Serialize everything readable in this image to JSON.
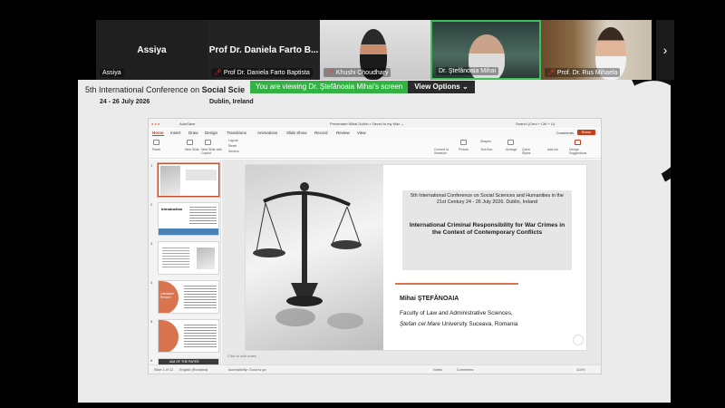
{
  "participants": [
    {
      "name": "Assiya",
      "label": "Assiya",
      "muted": false
    },
    {
      "name": "Prof Dr. Daniela Farto B...",
      "label": "Prof Dr. Daniela Farto Baptista",
      "muted": true
    },
    {
      "label": "Khushi Choudhary",
      "muted": true
    },
    {
      "label": "Dr. Ştefănoaia Mihai",
      "muted": false
    },
    {
      "label": "Prof. Dr. Rus Mihaela",
      "muted": true
    }
  ],
  "next_arrow": "›",
  "view_banner": {
    "viewing": "You are viewing  Dr. Ştefănoaia Mihai's screen",
    "options": "View Options ⌄"
  },
  "conference": {
    "header_prefix": "5th International Conference on ",
    "header_bold": "Social Scie",
    "dates": "24 - 26 July 2026",
    "place": "Dublin, Ireland"
  },
  "ppt": {
    "file_title": "Prezentare Mihai Dublin  •  Saved to my Mac ⌄",
    "autosave": "AutoSave",
    "search": "Search (Cmd + Ctrl + U)",
    "menu": [
      "Home",
      "Insert",
      "Draw",
      "Design",
      "Transitions",
      "Animations",
      "Slide Show",
      "Record",
      "Review",
      "View"
    ],
    "comments_btn": "Comments",
    "share_btn": "Share",
    "ribbon": {
      "paste": "Paste",
      "new_slide": "New Slide",
      "new_slide_copilot": "New Slide with Copilot",
      "layout": "Layout",
      "reset": "Reset",
      "section": "Section",
      "convert": "Convert to SmartArt",
      "picture": "Picture",
      "shapes": "Shapes",
      "text_box": "Text Box",
      "arrange": "Arrange",
      "quick_styles": "Quick Styles",
      "add_ins": "Add-ins",
      "design_suggestions": "Design Suggestions"
    },
    "thumbs": [
      {
        "num": "1",
        "label": ""
      },
      {
        "num": "2",
        "label": "Introduction"
      },
      {
        "num": "3",
        "label": ""
      },
      {
        "num": "4",
        "label": "Literature Review"
      },
      {
        "num": "5",
        "label": ""
      },
      {
        "num": "6",
        "label": "AIM OF THE PAPER"
      }
    ],
    "slide": {
      "conf_text": "5th International Conference on Social Sciences and Humanities in the 21st Century 24 - 26 July 2026. Dublin, Ireland",
      "title": "International Criminal Responsibility for War Crimes in the Context of Contemporary Conflicts",
      "author": "Mihai ŞTEFĂNOAIA",
      "affiliation1": "Faculty of Law and Administrative Sciences,",
      "affiliation2_italic": "Ştefan cel Mare",
      "affiliation2_rest": " University Suceava, Romania"
    },
    "notes": "Click to add notes",
    "status": {
      "slide_count": "Slide 1 of 12",
      "language": "English (Romania)",
      "accessibility": "Accessibility: Good to go",
      "notes_btn": "Notes",
      "comments": "Comments",
      "zoom": "114%"
    }
  },
  "colors": {
    "active_speaker": "#3fbf5a",
    "viewing_banner": "#31b243",
    "ppt_accent": "#c43e1c",
    "slide_divider": "#d9744f"
  }
}
